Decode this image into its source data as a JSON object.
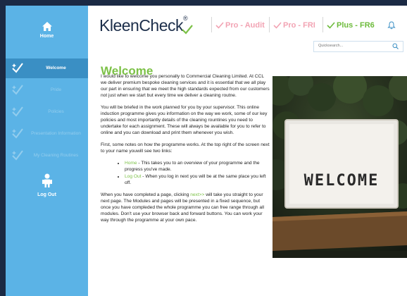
{
  "sidebar": {
    "home_label": "Home",
    "items": [
      {
        "label": "Welcome"
      },
      {
        "label": "Pride"
      },
      {
        "label": "Policies"
      },
      {
        "label": "Presentation Information"
      },
      {
        "label": "My Cleaning Routines"
      }
    ],
    "logout_label": "Log Out"
  },
  "header": {
    "brand": "KleenCheck",
    "brand_reg": "®",
    "links": [
      {
        "label": "Pro - Audit",
        "color": "#f2a3b3"
      },
      {
        "label": "Pro - FRI",
        "color": "#f2a3b3"
      },
      {
        "label": "Plus - FR6",
        "color": "#6dbb3b"
      }
    ],
    "search_placeholder": "Quicksearch..."
  },
  "content": {
    "title": "Welcome",
    "para1": "I would like to welcome you personally to Commercial Cleaning Limited. At CCL we deliver premium bespoke cleaning services and it is essential that we all play our part in ensuring that we meet the high standards expected from our customers not just when we start but every time we deliver a cleaning routne.",
    "para2": "You will be briefed in the work planned for you by your supervisor. This online induction programme gives you information on the way we work, some of our key policies and most importantly details of the cleaning rountines you need to undertake for each assignment. These will always be available for you to refer to online and you can download and print them whenever you wish.",
    "para3": "First, some notes on how the programme works. At the top right of the screen next to your name youwill see two links:",
    "bullet1_link": "Home",
    "bullet1_text": " - This takes you to an overview of your programme and the progress you've made.",
    "bullet2_link": "Log Out",
    "bullet2_text": " - When you log in next you will be at the same place you left off.",
    "para4_pre": "When you have completed a page, clicking ",
    "para4_link": "next>>",
    "para4_post": " will take you straight to your next page. The Modules and pages will be presented in a fixed sequence, but once you have compleded the whole programme you can free range through all modules. Don't use your browser back and forward buttons. You can work your way through the programme at your own pace.",
    "photo_sign": "WELCOME"
  },
  "colors": {
    "sidebar": "#5bb3e6",
    "sidebar_active": "#3a8fc4",
    "accent_green": "#7cc147",
    "brand_navy": "#1c2e4a"
  }
}
